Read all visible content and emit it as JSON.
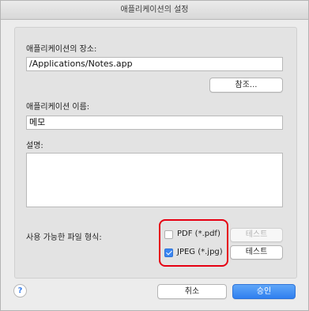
{
  "window": {
    "title": "애플리케이션의 설정"
  },
  "location": {
    "label": "애플리케이션의 장소:",
    "value": "/Applications/Notes.app",
    "browse_label": "참조..."
  },
  "app_name": {
    "label": "애플리케이션 이름:",
    "value": "메모"
  },
  "description": {
    "label": "설명:",
    "value": ""
  },
  "formats": {
    "label": "사용 가능한 파일 형식:",
    "items": [
      {
        "label": "PDF (*.pdf)",
        "checked": false,
        "test_label": "테스트",
        "test_enabled": false
      },
      {
        "label": "JPEG (*.jpg)",
        "checked": true,
        "test_label": "테스트",
        "test_enabled": true
      }
    ]
  },
  "footer": {
    "help_glyph": "?",
    "cancel_label": "취소",
    "ok_label": "승인"
  },
  "colors": {
    "accent": "#3b86f2",
    "highlight": "#e60012"
  }
}
